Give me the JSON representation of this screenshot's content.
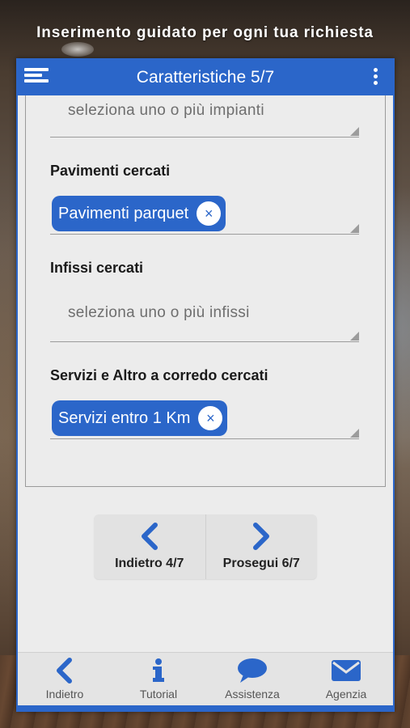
{
  "headline": "Inserimento guidato per ogni tua richiesta",
  "appbar": {
    "title": "Caratteristiche 5/7"
  },
  "form": {
    "impianti": {
      "placeholder": "seleziona uno o più impianti"
    },
    "pavimenti": {
      "label": "Pavimenti cercati",
      "chip": "Pavimenti parquet"
    },
    "infissi": {
      "label": "Infissi cercati",
      "placeholder": "seleziona uno o più infissi"
    },
    "servizi": {
      "label": "Servizi e Altro a corredo cercati",
      "chip": "Servizi entro 1 Km"
    },
    "chip_remove_symbol": "×"
  },
  "navigation": {
    "back_label": "Indietro 4/7",
    "next_label": "Prosegui 6/7"
  },
  "tabbar": {
    "items": [
      {
        "label": "Indietro",
        "icon": "chevron-left-icon"
      },
      {
        "label": "Tutorial",
        "icon": "info-icon"
      },
      {
        "label": "Assistenza",
        "icon": "chat-bubble-icon"
      },
      {
        "label": "Agenzia",
        "icon": "envelope-icon"
      }
    ]
  },
  "colors": {
    "accent": "#2b66c9",
    "panel": "#ececec"
  }
}
